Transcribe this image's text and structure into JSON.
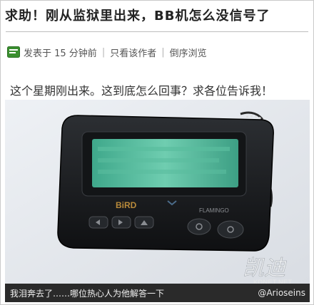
{
  "post": {
    "title": "求助！刚从监狱里出来，BB机怎么没信号了",
    "meta": {
      "posted": "发表于 15 分钟前",
      "only_author": "只看该作者",
      "reverse_view": "倒序浏览"
    },
    "body": "这个星期刚出来。这到底怎么回事？求各位告诉我！"
  },
  "photo": {
    "subject": "pager",
    "device_brand_text": "BiRD",
    "device_model_text": "FLAMINGO"
  },
  "caption": {
    "text": "我泪奔去了……哪位热心人为他解答一下",
    "handle": "@Arioseins"
  },
  "watermark": {
    "logo_text": "凯迪",
    "site": "KDNET.NET"
  },
  "colors": {
    "post_icon": "#3a8f2f",
    "caption_bg": "#2a2a2a",
    "pager_screen": "#59b89a"
  }
}
